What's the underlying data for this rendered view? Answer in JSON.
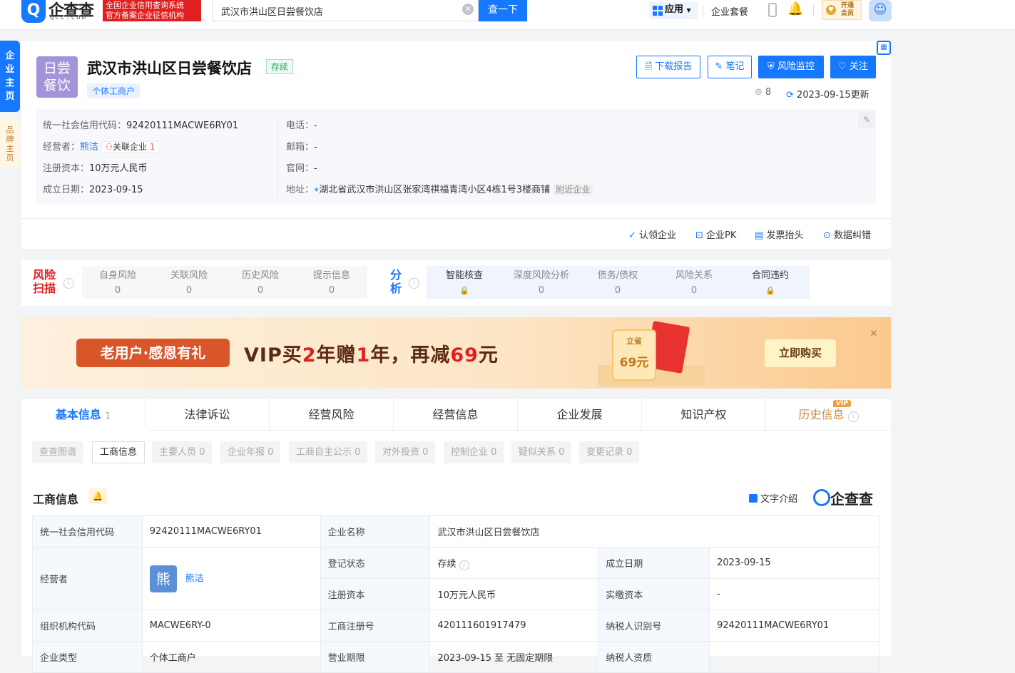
{
  "topbar": {
    "logo_char": "Q",
    "logo_text": "企查查",
    "logo_sub": "Qcc.com",
    "badge_line1": "全国企业信用查询系统",
    "badge_line2": "官方备案企业征信机构",
    "search_value": "武汉市洪山区日尝餐饮店",
    "search_button": "查一下",
    "app_label": "应用",
    "package_label": "企业套餐",
    "vip_line1": "开通",
    "vip_line2": "会员"
  },
  "sidebar": {
    "tab1": "企业主页",
    "tab2": "品牌主页"
  },
  "company": {
    "logo_line1": "日尝",
    "logo_line2": "餐饮",
    "name": "武汉市洪山区日尝餐饮店",
    "status": "存续",
    "type": "个体工商户",
    "views": "8",
    "updated": "2023-09-15更新"
  },
  "buttons": {
    "download": "下载报告",
    "note": "笔记",
    "monitor": "风险监控",
    "follow": "关注"
  },
  "info": {
    "credit_label": "统一社会信用代码：",
    "credit_value": "92420111MACWE6RY01",
    "operator_label": "经营者：",
    "operator_value": "熊洁",
    "related_label": "关联企业",
    "related_count": "1",
    "capital_label": "注册资本：",
    "capital_value": "10万元人民币",
    "founded_label": "成立日期：",
    "founded_value": "2023-09-15",
    "phone_label": "电话：",
    "phone_value": "-",
    "email_label": "邮箱：",
    "email_value": "-",
    "web_label": "官网：",
    "web_value": "-",
    "address_label": "地址：",
    "address_value": "湖北省武汉市洪山区张家湾祺福青湾小区4栋1号3楼商铺",
    "nearby": "附近企业"
  },
  "actions": {
    "claim": "认领企业",
    "pk": "企业PK",
    "invoice": "发票抬头",
    "correct": "数据纠错"
  },
  "risk": {
    "title1": "风险",
    "title2": "扫描",
    "items": [
      {
        "label": "自身风险",
        "value": "0"
      },
      {
        "label": "关联风险",
        "value": "0"
      },
      {
        "label": "历史风险",
        "value": "0"
      },
      {
        "label": "提示信息",
        "value": "0"
      }
    ]
  },
  "analysis": {
    "title1": "分",
    "title2": "析",
    "items": [
      {
        "label": "智能核查",
        "value": "🔒"
      },
      {
        "label": "深度风险分析",
        "value": "0"
      },
      {
        "label": "债务/债权",
        "value": "0"
      },
      {
        "label": "风险关系",
        "value": "0"
      },
      {
        "label": "合同违约",
        "value": "🔒"
      }
    ]
  },
  "banner": {
    "pill": "老用户·感恩有礼",
    "t1": "VIP买",
    "t2": "2",
    "t3": "年赠",
    "t4": "1",
    "t5": "年，再减",
    "t6": "69",
    "t7": "元",
    "deco_top": "立省",
    "deco_amount": "69元",
    "buy": "立即购买"
  },
  "tabs": [
    {
      "label": "基本信息",
      "count": "1"
    },
    {
      "label": "法律诉讼"
    },
    {
      "label": "经营风险"
    },
    {
      "label": "经营信息"
    },
    {
      "label": "企业发展"
    },
    {
      "label": "知识产权"
    },
    {
      "label": "历史信息",
      "badge": "VIP"
    }
  ],
  "subtabs": [
    "查查图谱",
    "工商信息",
    "主要人员 0",
    "企业年报 0",
    "工商自主公示 0",
    "对外投资 0",
    "控制企业 0",
    "疑似关系 0",
    "变更记录 0"
  ],
  "section": {
    "title": "工商信息",
    "text_intro": "文字介绍",
    "brand": "企查查"
  },
  "table": {
    "credit_k": "统一社会信用代码",
    "credit_v": "92420111MACWE6RY01",
    "name_k": "企业名称",
    "name_v": "武汉市洪山区日尝餐饮店",
    "operator_k": "经营者",
    "operator_avatar": "熊",
    "operator_v": "熊洁",
    "status_k": "登记状态",
    "status_v": "存续",
    "founded_k": "成立日期",
    "founded_v": "2023-09-15",
    "capital_k": "注册资本",
    "capital_v": "10万元人民币",
    "paid_k": "实缴资本",
    "paid_v": "-",
    "org_k": "组织机构代码",
    "org_v": "MACWE6RY-0",
    "reg_k": "工商注册号",
    "reg_v": "420111601917479",
    "tax_k": "纳税人识别号",
    "tax_v": "92420111MACWE6RY01",
    "type_k": "企业类型",
    "type_v": "个体工商户",
    "term_k": "营业期限",
    "term_v": "2023-09-15 至 无固定期限",
    "taxq_k": "纳税人资质",
    "taxq_v": ""
  }
}
